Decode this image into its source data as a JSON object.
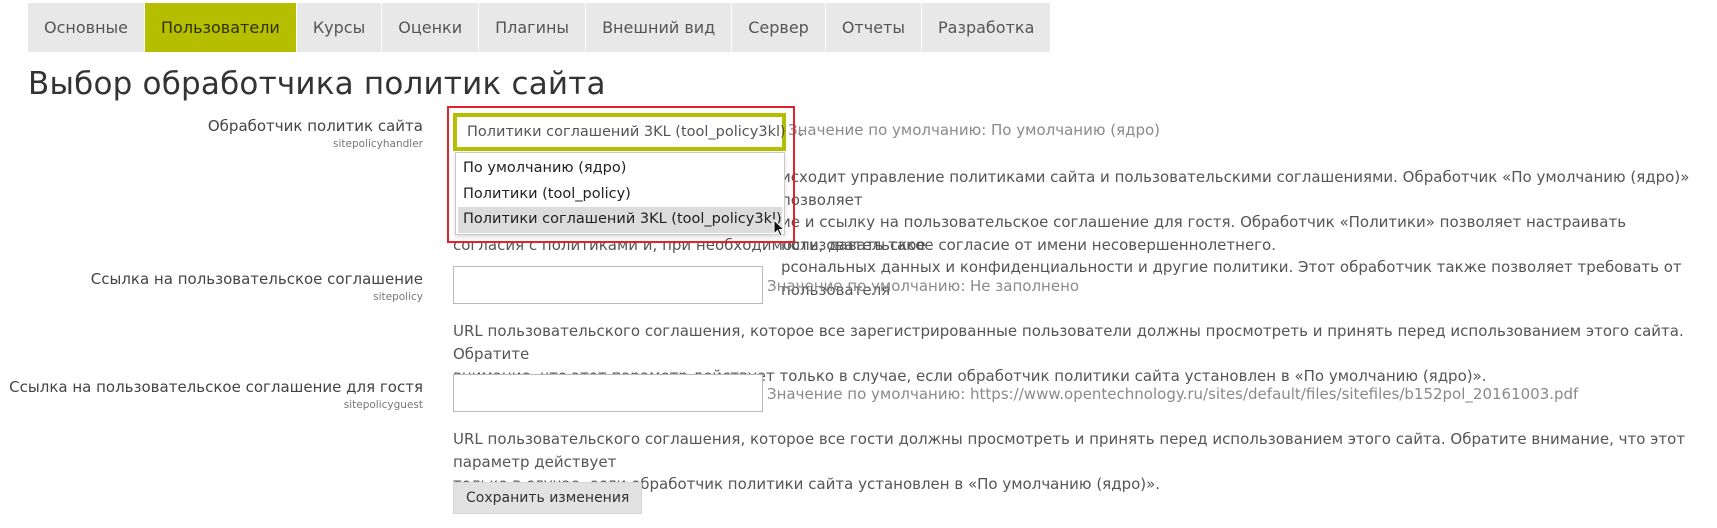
{
  "tabs": [
    {
      "label": "Основные",
      "active": false
    },
    {
      "label": "Пользователи",
      "active": true
    },
    {
      "label": "Курсы",
      "active": false
    },
    {
      "label": "Оценки",
      "active": false
    },
    {
      "label": "Плагины",
      "active": false
    },
    {
      "label": "Внешний вид",
      "active": false
    },
    {
      "label": "Сервер",
      "active": false
    },
    {
      "label": "Отчеты",
      "active": false
    },
    {
      "label": "Разработка",
      "active": false
    }
  ],
  "page_title": "Выбор обработчика политик сайта",
  "handler": {
    "label": "Обработчик политик сайта",
    "key": "sitepolicyhandler",
    "selected": "Политики соглашений 3KL (tool_policy3kl)",
    "default": "Значение по умолчанию: По умолчанию (ядро)",
    "options": [
      "По умолчанию (ядро)",
      "Политики (tool_policy)",
      "Политики соглашений 3KL (tool_policy3kl)"
    ],
    "desc_lines": [
      "исходит управление политиками сайта и пользовательскими соглашениями. Обработчик «По умолчанию (ядро)» позволяет",
      "ие и ссылку на пользовательское соглашение для гостя. Обработчик «Политики» позволяет настраивать пользовательское",
      "рсональных данных и конфиденциальности и другие политики. Этот обработчик также позволяет требовать от пользователя",
      "согласия с политиками и, при необходимости, давать такое согласие от имени несовершеннолетнего."
    ]
  },
  "sitepolicy": {
    "label": "Ссылка на пользовательское соглашение",
    "key": "sitepolicy",
    "value": "",
    "default": "Значение по умолчанию: Не заполнено",
    "desc_lines": [
      "URL пользовательского соглашения, которое все зарегистрированные пользователи должны просмотреть и принять перед использованием этого сайта. Обратите",
      "внимание, что этот параметр действует только в случае, если обработчик политики сайта установлен в «По умолчанию (ядро)»."
    ]
  },
  "sitepolicyguest": {
    "label": "Ссылка на пользовательское соглашение для гостя",
    "key": "sitepolicyguest",
    "value": "",
    "default": "Значение по умолчанию: https://www.opentechnology.ru/sites/default/files/sitefiles/b152pol_20161003.pdf",
    "desc_lines": [
      "URL пользовательского соглашения, которое все гости должны просмотреть и принять перед использованием этого сайта. Обратите внимание, что этот параметр действует",
      "только в случае, если обработчик политики сайта установлен в «По умолчанию (ядро)»."
    ]
  },
  "save_button": "Сохранить изменения",
  "colors": {
    "accent": "#b5bf00",
    "highlight": "#e2232e"
  }
}
